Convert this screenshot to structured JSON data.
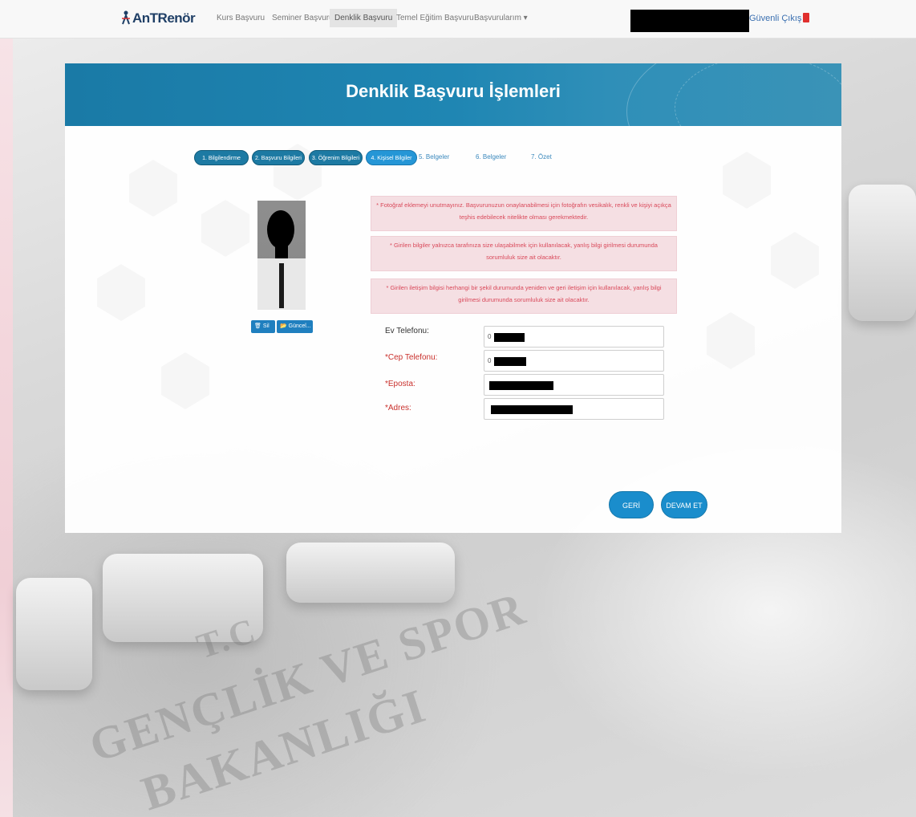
{
  "navbar": {
    "brand": "AnTRenör",
    "items": [
      {
        "label": "Kurs Başvuru",
        "active": false
      },
      {
        "label": "Seminer Başvuru",
        "active": false
      },
      {
        "label": "Denklik Başvuru",
        "active": true
      },
      {
        "label": "Temel Eğitim Başvuru",
        "active": false
      },
      {
        "label": "Başvurularım ▾",
        "active": false
      }
    ],
    "logout": "Güvenli Çıkış"
  },
  "header": {
    "title": "Denklik Başvuru İşlemleri"
  },
  "stepper": {
    "steps": [
      {
        "label": "1. Bilgilendirme",
        "state": "done"
      },
      {
        "label": "2. Başvuru Bilgileri",
        "state": "done"
      },
      {
        "label": "3. Öğrenim Bilgileri",
        "state": "done"
      },
      {
        "label": "4. Kişisel Bilgiler",
        "state": "current"
      },
      {
        "label": "5. Belgeler",
        "state": "todo"
      },
      {
        "label": "6. Belgeler",
        "state": "todo"
      },
      {
        "label": "7. Özet",
        "state": "todo"
      }
    ]
  },
  "photo": {
    "delete_label": "Sil",
    "upload_label": "Güncel..."
  },
  "alerts": [
    "* Fotoğraf eklemeyi unutmayınız. Başvurunuzun onaylanabilmesi için fotoğrafın vesikalık, renkli ve kişiyi açıkça teşhis edebilecek nitelikte olması gerekmektedir.",
    "* Girilen bilgiler yalnızca tarafınıza size ulaşabilmek için kullanılacak, yanlış bilgi girilmesi durumunda sorumluluk size ait olacaktır.",
    "* Girilen iletişim bilgisi herhangi bir şekil durumunda yeniden ve geri iletişim için kullanılacak, yanlış bilgi girilmesi durumunda sorumluluk size ait olacaktır."
  ],
  "form": {
    "home_phone": {
      "label": "Ev Telefonu:",
      "value": "0",
      "required": false
    },
    "mobile_phone": {
      "label": "*Cep Telefonu:",
      "value": "0",
      "required": true
    },
    "email": {
      "label": "*Eposta:",
      "value": "",
      "required": true
    },
    "address": {
      "label": "*Adres:",
      "value": "",
      "required": true
    }
  },
  "buttons": {
    "back": "GERİ",
    "next": "DEVAM ET"
  },
  "colors": {
    "primary": "#1a7aa6",
    "alert_bg": "#f5dfe3",
    "alert_text": "#d9495a",
    "required": "#c9302c"
  },
  "background": {
    "watermark_lines": [
      "T.C",
      "GENÇLİK VE SPOR",
      "BAKANLIĞI"
    ]
  }
}
